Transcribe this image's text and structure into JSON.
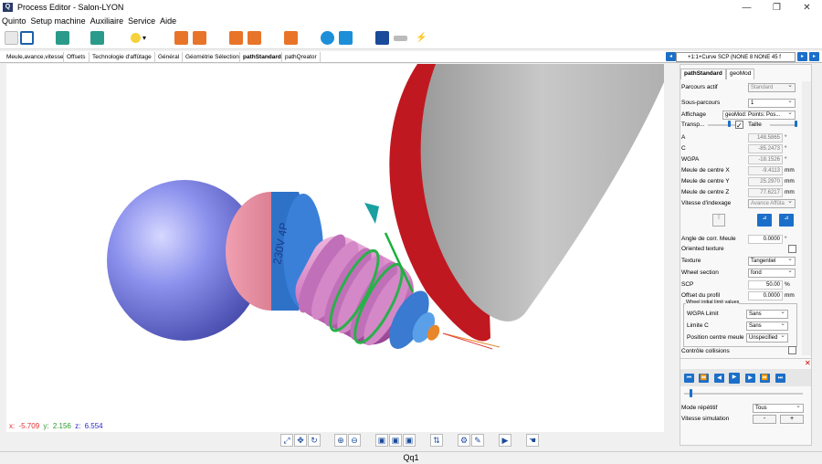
{
  "window": {
    "title": "Process Editor - Salon-LYON",
    "minimize": "—",
    "maximize": "❐",
    "close": "✕"
  },
  "menu": [
    "Quinto",
    "Setup machine",
    "Auxiliaire",
    "Service",
    "Aide"
  ],
  "tabs": [
    "Meule,avance,vitesse",
    "Offsets",
    "Technologie d'affûtage",
    "Général",
    "Géométrie Sélection",
    "pathStandard",
    "pathQreator"
  ],
  "curve_selector": "+1:1+Curve SCP (NONE 8 NONE 45 f",
  "viewport": {
    "coords": {
      "x_label": "x:",
      "x": "-5.709",
      "y_label": "y:",
      "y": "2.156",
      "z_label": "z:",
      "z": "6.554"
    },
    "wheel_marking": "230V 4P"
  },
  "panel": {
    "tabs": [
      "pathStandard",
      "geoMod"
    ],
    "parcours_actif": {
      "label": "Parcours actif",
      "value": "Standard"
    },
    "sous_parcours": {
      "label": "Sous-parcours",
      "value": "1"
    },
    "affichage": {
      "label": "Affichage",
      "value": "geoMod: Points: Pos..."
    },
    "transp": {
      "label": "Transp...",
      "taille": "Taille"
    },
    "A": {
      "label": "A",
      "value": "148.5865",
      "unit": "°"
    },
    "C": {
      "label": "C",
      "value": "-85.2473",
      "unit": "°"
    },
    "WGPA": {
      "label": "WGPA",
      "value": "-18.1526",
      "unit": "°"
    },
    "meule_x": {
      "label": "Meule de centre X",
      "value": "-9.4113",
      "unit": "mm"
    },
    "meule_y": {
      "label": "Meule de centre Y",
      "value": "25.2970",
      "unit": "mm"
    },
    "meule_z": {
      "label": "Meule de centre Z",
      "value": "77.6217",
      "unit": "mm"
    },
    "vitesse_indexage": {
      "label": "Vitesse d'indexage",
      "value": "Avance Affûta"
    },
    "angle_corr": {
      "label": "Angle de corr. Meule",
      "value": "0.0000",
      "unit": "°"
    },
    "oriented_texture": {
      "label": "Oriented texture"
    },
    "texture": {
      "label": "Texture",
      "value": "Tangentiel"
    },
    "wheel_section": {
      "label": "Wheel section",
      "value": "fond"
    },
    "scp": {
      "label": "SCP",
      "value": "50.00",
      "unit": "%"
    },
    "offset_profil": {
      "label": "Offset du profil",
      "value": "0.0000",
      "unit": "mm"
    },
    "group_title": "Wheel initial limit values",
    "wgpa_limit": {
      "label": "WGPA Limit",
      "value": "Sans"
    },
    "limite_c": {
      "label": "Limite C",
      "value": "Sans"
    },
    "position_centre": {
      "label": "Position centre meule",
      "value": "Unspecified"
    },
    "controle_collisions": {
      "label": "Contrôle collisions"
    },
    "mode_repetitif": {
      "label": "Mode répétitif",
      "value": "Tous"
    },
    "vitesse_simulation": {
      "label": "Vitesse simulation",
      "minus": "-",
      "plus": "+"
    },
    "player": [
      "⏮",
      "⏪",
      "◀",
      "▶",
      "▶",
      "⏩",
      "⏭"
    ]
  },
  "status": "Qq1",
  "colors": {
    "sphere": "#7b82e6",
    "wheel": "#e59bc8",
    "body": "#b8b8b8",
    "rim": "#c01820",
    "accent": "#1c6fc8"
  }
}
